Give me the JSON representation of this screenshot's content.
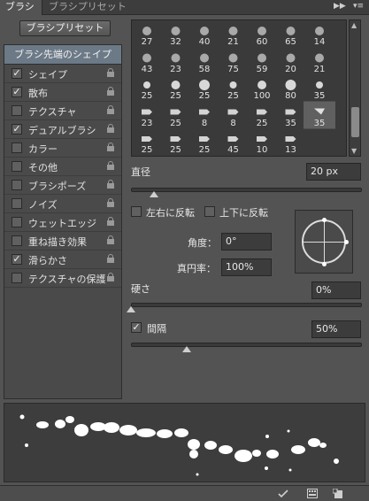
{
  "tabs": [
    {
      "label": "ブラシ",
      "active": true
    },
    {
      "label": "ブラシプリセット",
      "active": false
    }
  ],
  "tabbar_icons": [
    "collapse-icon",
    "panel-menu-icon"
  ],
  "preset_button": {
    "label": "ブラシプリセット"
  },
  "list": {
    "header": "ブラシ先端のシェイプ",
    "items": [
      {
        "label": "シェイプ",
        "checked": true
      },
      {
        "label": "散布",
        "checked": true
      },
      {
        "label": "テクスチャ",
        "checked": false
      },
      {
        "label": "デュアルブラシ",
        "checked": true
      },
      {
        "label": "カラー",
        "checked": false
      },
      {
        "label": "その他",
        "checked": false
      },
      {
        "label": "ブラシポーズ",
        "checked": false
      },
      {
        "label": "ノイズ",
        "checked": false
      },
      {
        "label": "ウェットエッジ",
        "checked": false
      },
      {
        "label": "重ね描き効果",
        "checked": false
      },
      {
        "label": "滑らかさ",
        "checked": true
      },
      {
        "label": "テクスチャの保護",
        "checked": false
      }
    ]
  },
  "brush_grid": {
    "rows": [
      [
        "27",
        "32",
        "40",
        "21",
        "60",
        "65",
        "14"
      ],
      [
        "43",
        "23",
        "58",
        "75",
        "59",
        "20",
        "21"
      ],
      [
        "25",
        "25",
        "25",
        "25",
        "100",
        "80",
        "35"
      ],
      [
        "23",
        "25",
        "8",
        "8",
        "25",
        "35",
        "35"
      ],
      [
        "25",
        "25",
        "25",
        "45",
        "10",
        "13",
        ""
      ]
    ],
    "selected": "35"
  },
  "controls": {
    "diameter_label": "直径",
    "diameter_value": "20 px",
    "diameter_slider": 0.1,
    "flip_x_label": "左右に反転",
    "flip_x_checked": false,
    "flip_y_label": "上下に反転",
    "flip_y_checked": false,
    "angle_label": "角度：",
    "angle_value": "0°",
    "roundness_label": "真円率：",
    "roundness_value": "100%",
    "hardness_label": "硬さ",
    "hardness_value": "0%",
    "hardness_slider": 0.0,
    "spacing_label": "間隔",
    "spacing_checked": true,
    "spacing_value": "50%",
    "spacing_slider": 0.24
  },
  "bottom_icons": [
    "toggle-brush-preview-icon",
    "grid-icon",
    "new-preset-icon"
  ]
}
